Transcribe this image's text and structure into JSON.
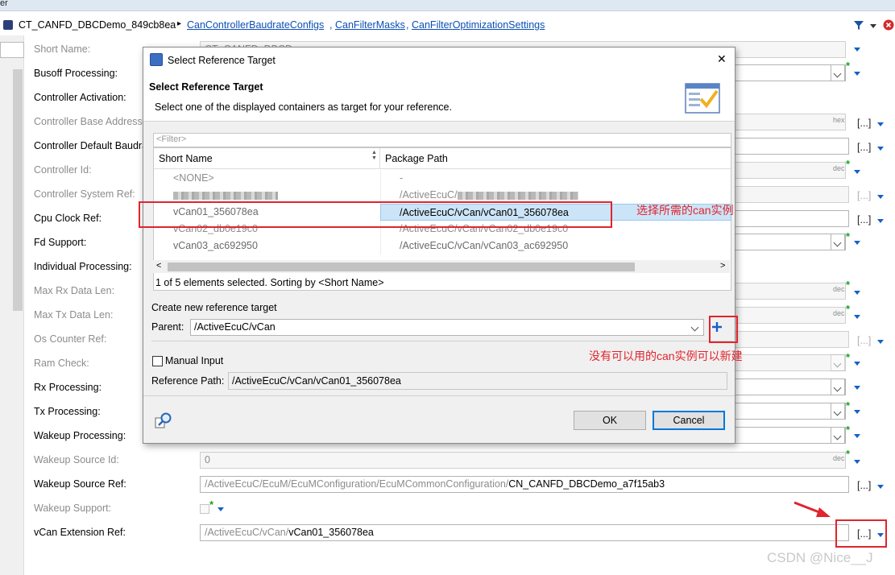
{
  "topbar": {
    "label": "er"
  },
  "breadcrumb": {
    "root": "CT_CANFD_DBCDemo_849cb8ea",
    "separator": "▸",
    "links": [
      "CanControllerBaudrateConfigs",
      "CanFilterMasks",
      "CanFilterOptimizationSettings"
    ]
  },
  "form": {
    "rows": [
      {
        "label": "Short Name:",
        "enabled": false,
        "value": "CT_CANFD_DBCD..."
      },
      {
        "label": "Busoff Processing:",
        "enabled": true,
        "value": ""
      },
      {
        "label": "Controller Activation:",
        "enabled": true,
        "value": ""
      },
      {
        "label": "Controller Base Address:",
        "enabled": false,
        "value": ""
      },
      {
        "label": "Controller Default Baudrate:",
        "enabled": true,
        "value": ""
      },
      {
        "label": "Controller Id:",
        "enabled": false,
        "value": ""
      },
      {
        "label": "Controller System Ref:",
        "enabled": false,
        "value": ""
      },
      {
        "label": "Cpu Clock Ref:",
        "enabled": true,
        "value": ""
      },
      {
        "label": "Fd Support:",
        "enabled": true,
        "value": ""
      },
      {
        "label": "Individual Processing:",
        "enabled": true,
        "value": ""
      },
      {
        "label": "Max Rx Data Len:",
        "enabled": false,
        "value": ""
      },
      {
        "label": "Max Tx Data Len:",
        "enabled": false,
        "value": ""
      },
      {
        "label": "Os Counter Ref:",
        "enabled": false,
        "value": ""
      },
      {
        "label": "Ram Check:",
        "enabled": false,
        "value": ""
      },
      {
        "label": "Rx Processing:",
        "enabled": true,
        "value": ""
      },
      {
        "label": "Tx Processing:",
        "enabled": true,
        "value": ""
      },
      {
        "label": "Wakeup Processing:",
        "enabled": true,
        "value": ""
      },
      {
        "label": "Wakeup Source Id:",
        "enabled": false,
        "value": "0"
      },
      {
        "label": "Wakeup Source Ref:",
        "enabled": true,
        "value_prefix": "/ActiveEcuC/EcuM/EcuMConfiguration/EcuMCommonConfiguration/",
        "value_suffix": "CN_CANFD_DBCDemo_a7f15ab3"
      },
      {
        "label": "Wakeup Support:",
        "enabled": false,
        "value": ""
      },
      {
        "label": "vCan Extension Ref:",
        "enabled": true,
        "value_prefix": "/ActiveEcuC/vCan/",
        "value_suffix": "vCan01_356078ea"
      }
    ],
    "hex_tag": "hex",
    "dec_tag": "dec",
    "browse_label": "[...]",
    "star": "*"
  },
  "dialog": {
    "title": "Select Reference Target",
    "header_title": "Select Reference Target",
    "header_desc": "Select one of the displayed containers as target for your reference.",
    "filter_placeholder": "<Filter>",
    "columns": [
      "Short Name",
      "Package Path"
    ],
    "rows": [
      {
        "short": "<NONE>",
        "path": "-",
        "blurred": false
      },
      {
        "short": "",
        "path": "/ActiveEcuC/",
        "blurred": true
      },
      {
        "short": "vCan01_356078ea",
        "path": "/ActiveEcuC/vCan/vCan01_356078ea",
        "selected": true
      },
      {
        "short": "vCan02_db0e19c0",
        "path": "/ActiveEcuC/vCan/vCan02_db0e19c0"
      },
      {
        "short": "vCan03_ac692950",
        "path": "/ActiveEcuC/vCan/vCan03_ac692950"
      }
    ],
    "status": "1 of 5 elements selected. Sorting by <Short Name>",
    "create_label": "Create new reference target",
    "parent_label": "Parent:",
    "parent_value": "/ActiveEcuC/vCan",
    "manual_label": "Manual Input",
    "ref_path_label": "Reference Path:",
    "ref_path_value": "/ActiveEcuC/vCan/vCan01_356078ea",
    "ok": "OK",
    "cancel": "Cancel",
    "close_glyph": "✕"
  },
  "annotations": {
    "select_note": "选择所需的can实例",
    "create_note": "没有可以用的can实例可以新建",
    "color": "#e1242d"
  },
  "watermark": "CSDN @Nice__J"
}
